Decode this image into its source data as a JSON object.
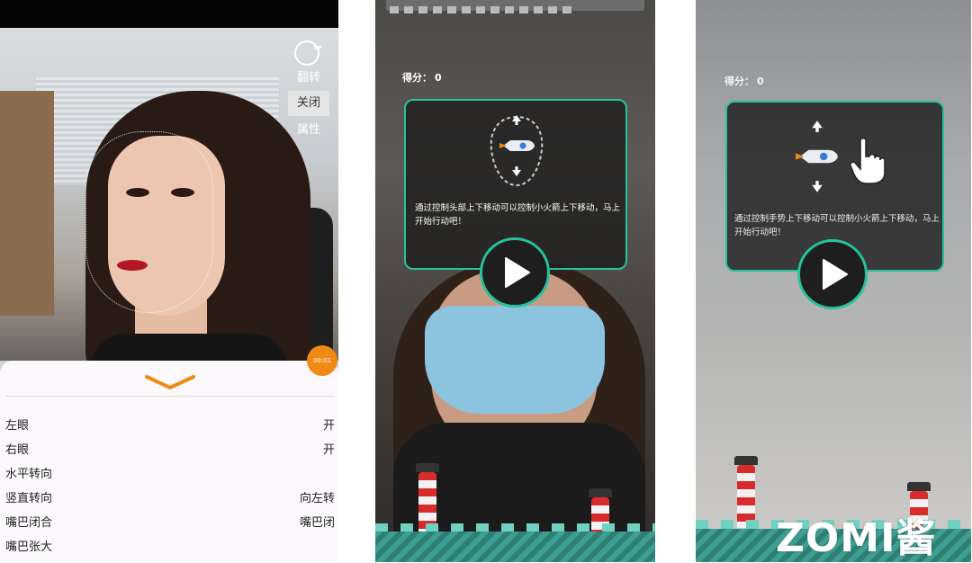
{
  "phone1": {
    "side_buttons": {
      "flip": "翻转",
      "close": "关闭",
      "properties": "属性"
    },
    "record_timer": "00:01",
    "attributes": [
      {
        "label": "左眼",
        "value": "开"
      },
      {
        "label": "右眼",
        "value": "开"
      },
      {
        "label": "水平转向",
        "value": ""
      },
      {
        "label": "竖直转向",
        "value": "向左转"
      },
      {
        "label": "嘴巴闭合",
        "value": "嘴巴闭"
      },
      {
        "label": "嘴巴张大",
        "value": ""
      }
    ],
    "colors": {
      "accent": "#f08a14",
      "panel_bg": "#fcf9fc"
    }
  },
  "phone2": {
    "score_label": "得分：",
    "score_value": "0",
    "instruction": "通过控制头部上下移动可以控制小火箭上下移动，马上开始行动吧！",
    "icons": [
      "head-outline-icon",
      "rocket-icon",
      "arrow-up-icon",
      "arrow-down-icon",
      "play-icon"
    ]
  },
  "phone3": {
    "score_label": "得分：",
    "score_value": "0",
    "instruction": "通过控制手势上下移动可以控制小火箭上下移动，马上开始行动吧！",
    "icons": [
      "rocket-icon",
      "hand-pointer-icon",
      "arrow-up-icon",
      "arrow-down-icon",
      "play-icon"
    ]
  },
  "watermark": "ZOMI酱",
  "theme": {
    "card_border": "#25c2a0",
    "card_bg": "#1e1e1e"
  }
}
